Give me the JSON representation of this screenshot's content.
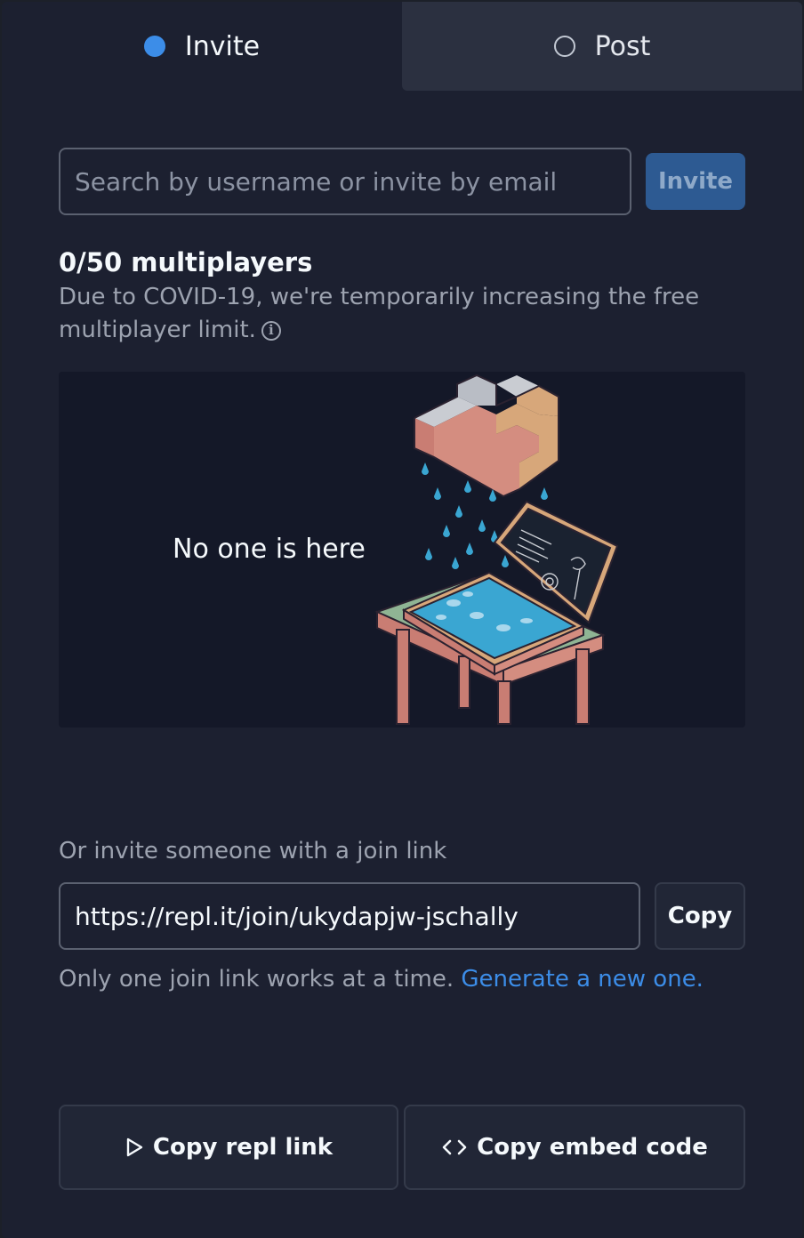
{
  "tabs": [
    {
      "label": "Invite",
      "selected": true
    },
    {
      "label": "Post",
      "selected": false
    }
  ],
  "search": {
    "placeholder": "Search by username or invite by email",
    "value": "",
    "button_label": "Invite"
  },
  "multiplayers": {
    "count_label": "0/50 multiplayers",
    "note": "Due to COVID-19, we're temporarily increasing the free multiplayer limit."
  },
  "empty_state": {
    "text": "No one is here"
  },
  "join": {
    "label": "Or invite someone with a join link",
    "link": "https://repl.it/join/ukydapjw-jschally",
    "copy_label": "Copy",
    "note": "Only one join link works at a time.",
    "generate_label": "Generate a new one."
  },
  "actions": {
    "copy_repl_link": "Copy repl link",
    "copy_embed_code": "Copy embed code"
  },
  "colors": {
    "accent": "#3c8de8",
    "background": "#1c2030",
    "invite_button": "#2d5a92"
  }
}
